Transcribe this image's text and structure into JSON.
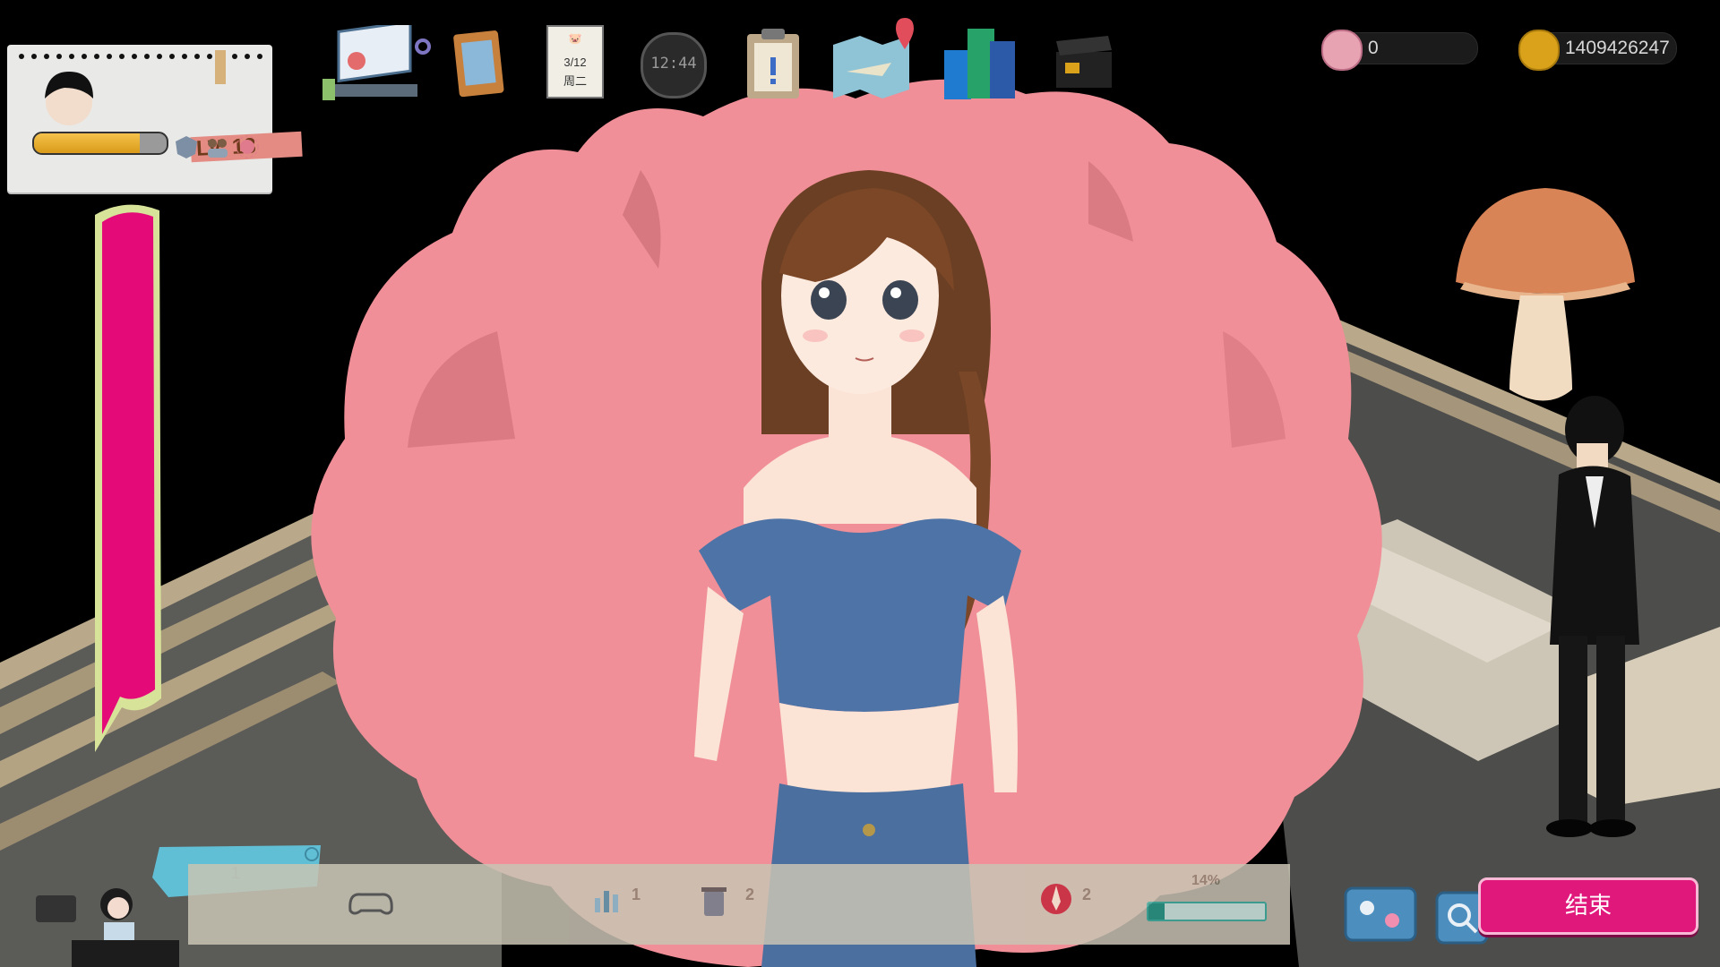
{
  "profile": {
    "level_label": "LV. 13",
    "xp_fraction": 0.8
  },
  "hud": {
    "clock": "12:44",
    "calendar_date": "3/12",
    "calendar_weekday": "周二",
    "gems": "0",
    "coins": "1409426247"
  },
  "icons": {
    "top": [
      "computer-icon",
      "clipboard-board-icon",
      "calendar-icon",
      "clock-icon",
      "task-clipboard-icon",
      "map-icon",
      "buildings-icon",
      "clapperboard-icon"
    ],
    "bottom": [
      "controller-icon",
      "stats-icon",
      "trash-icon",
      "rocket-icon"
    ]
  },
  "bottom_bar": {
    "cyan_value": "1",
    "stat_a": "1",
    "stat_b": "2",
    "stat_c": "2",
    "progress_label": "14%",
    "progress_fraction": 0.14
  },
  "end_button": {
    "label": "结束"
  },
  "colors": {
    "accent_pink": "#e0187c",
    "splash_pink": "#f08f97",
    "bar_magenta": "#e40b78",
    "bar_outline": "#d8e39a",
    "coin_gold": "#d9a21a"
  }
}
